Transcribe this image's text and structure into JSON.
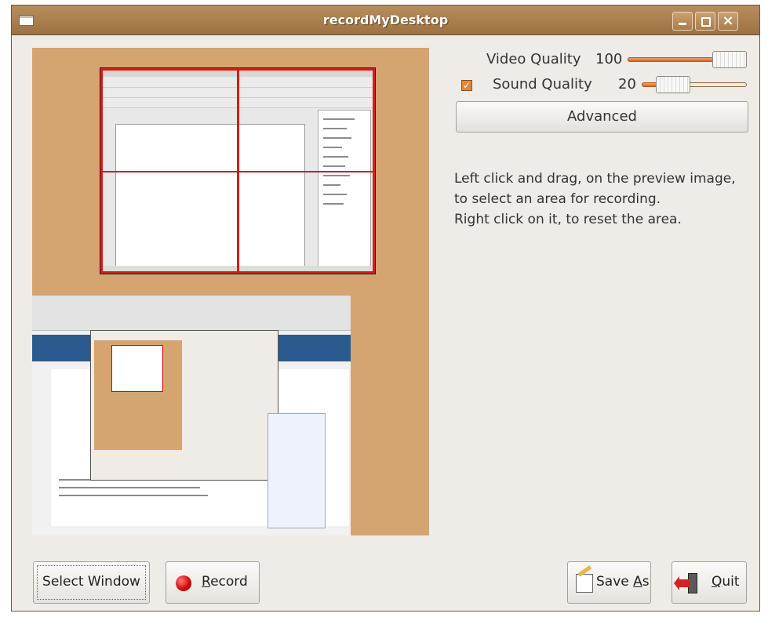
{
  "window": {
    "title": "recordMyDesktop",
    "controls": [
      "minimize-icon",
      "maximize-icon",
      "close-icon"
    ]
  },
  "settings": {
    "video_quality": {
      "label": "Video Quality",
      "value": "100",
      "level": 100,
      "max": 100
    },
    "sound_quality": {
      "label": "Sound Quality",
      "value": "20",
      "level": 20,
      "max": 100,
      "checked": true
    },
    "advanced_label": "Advanced"
  },
  "info": {
    "line1": "Left click and drag, on the preview image,",
    "line2": "to select an area for recording.",
    "line3": "Right click on it, to reset the area."
  },
  "buttons": {
    "select_window": "Select Window",
    "record_pre": "",
    "record_mnemonic": "R",
    "record_post": "ecord",
    "save_pre": "Save ",
    "save_mnemonic": "A",
    "save_post": "s",
    "quit_pre": "",
    "quit_mnemonic": "Q",
    "quit_post": "uit"
  },
  "colors": {
    "titlebar": "#a97d4c",
    "preview_bg": "#d4a570",
    "selection": "#d91a1a",
    "slider_fill": "#e27a3c",
    "record": "#d40000"
  },
  "icons": {
    "record": "record-icon",
    "save": "save-as-icon",
    "quit": "quit-icon",
    "app": "window-icon"
  }
}
